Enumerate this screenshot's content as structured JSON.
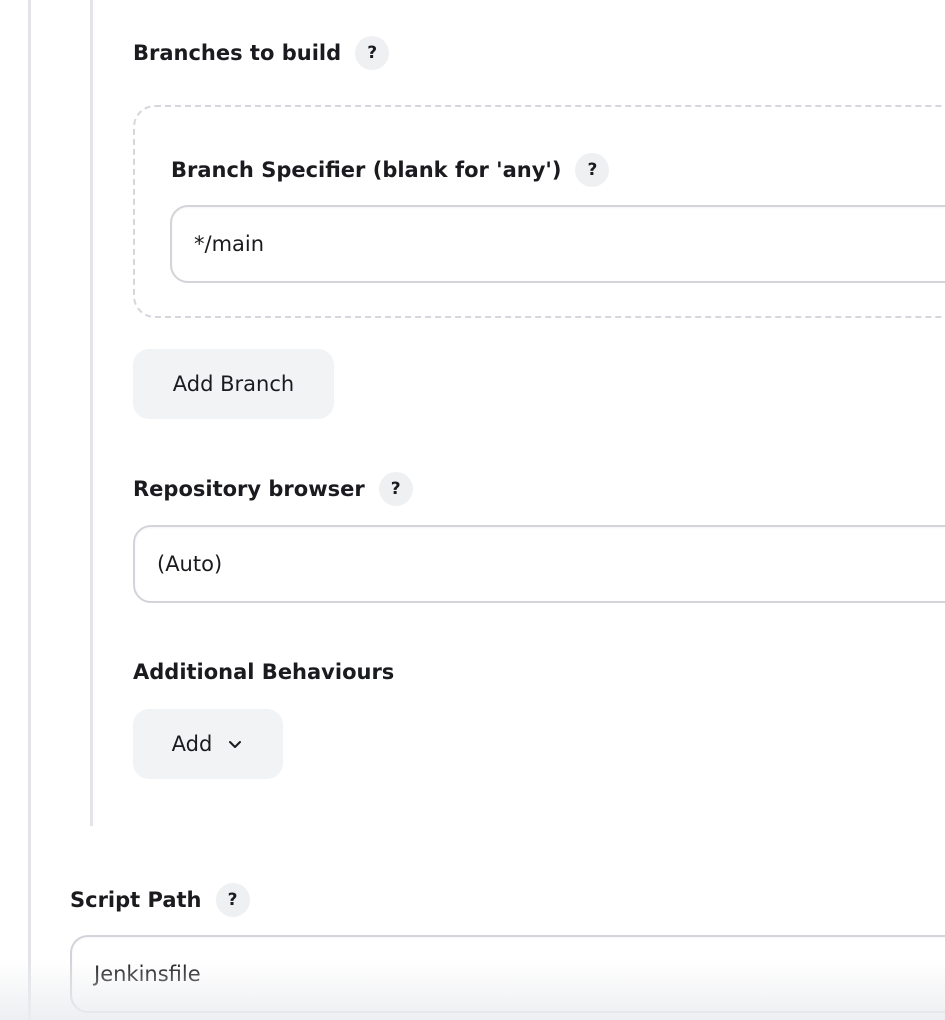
{
  "branches_to_build": {
    "label": "Branches to build",
    "help": "?",
    "branch_specifier": {
      "label": "Branch Specifier (blank for 'any')",
      "help": "?",
      "value": "*/main"
    },
    "add_branch_label": "Add Branch"
  },
  "repository_browser": {
    "label": "Repository browser",
    "help": "?",
    "selected": "(Auto)"
  },
  "additional_behaviours": {
    "label": "Additional Behaviours",
    "add_label": "Add",
    "add_icon": "chevron-down-icon"
  },
  "script_path": {
    "label": "Script Path",
    "help": "?",
    "value": "Jenkinsfile"
  }
}
